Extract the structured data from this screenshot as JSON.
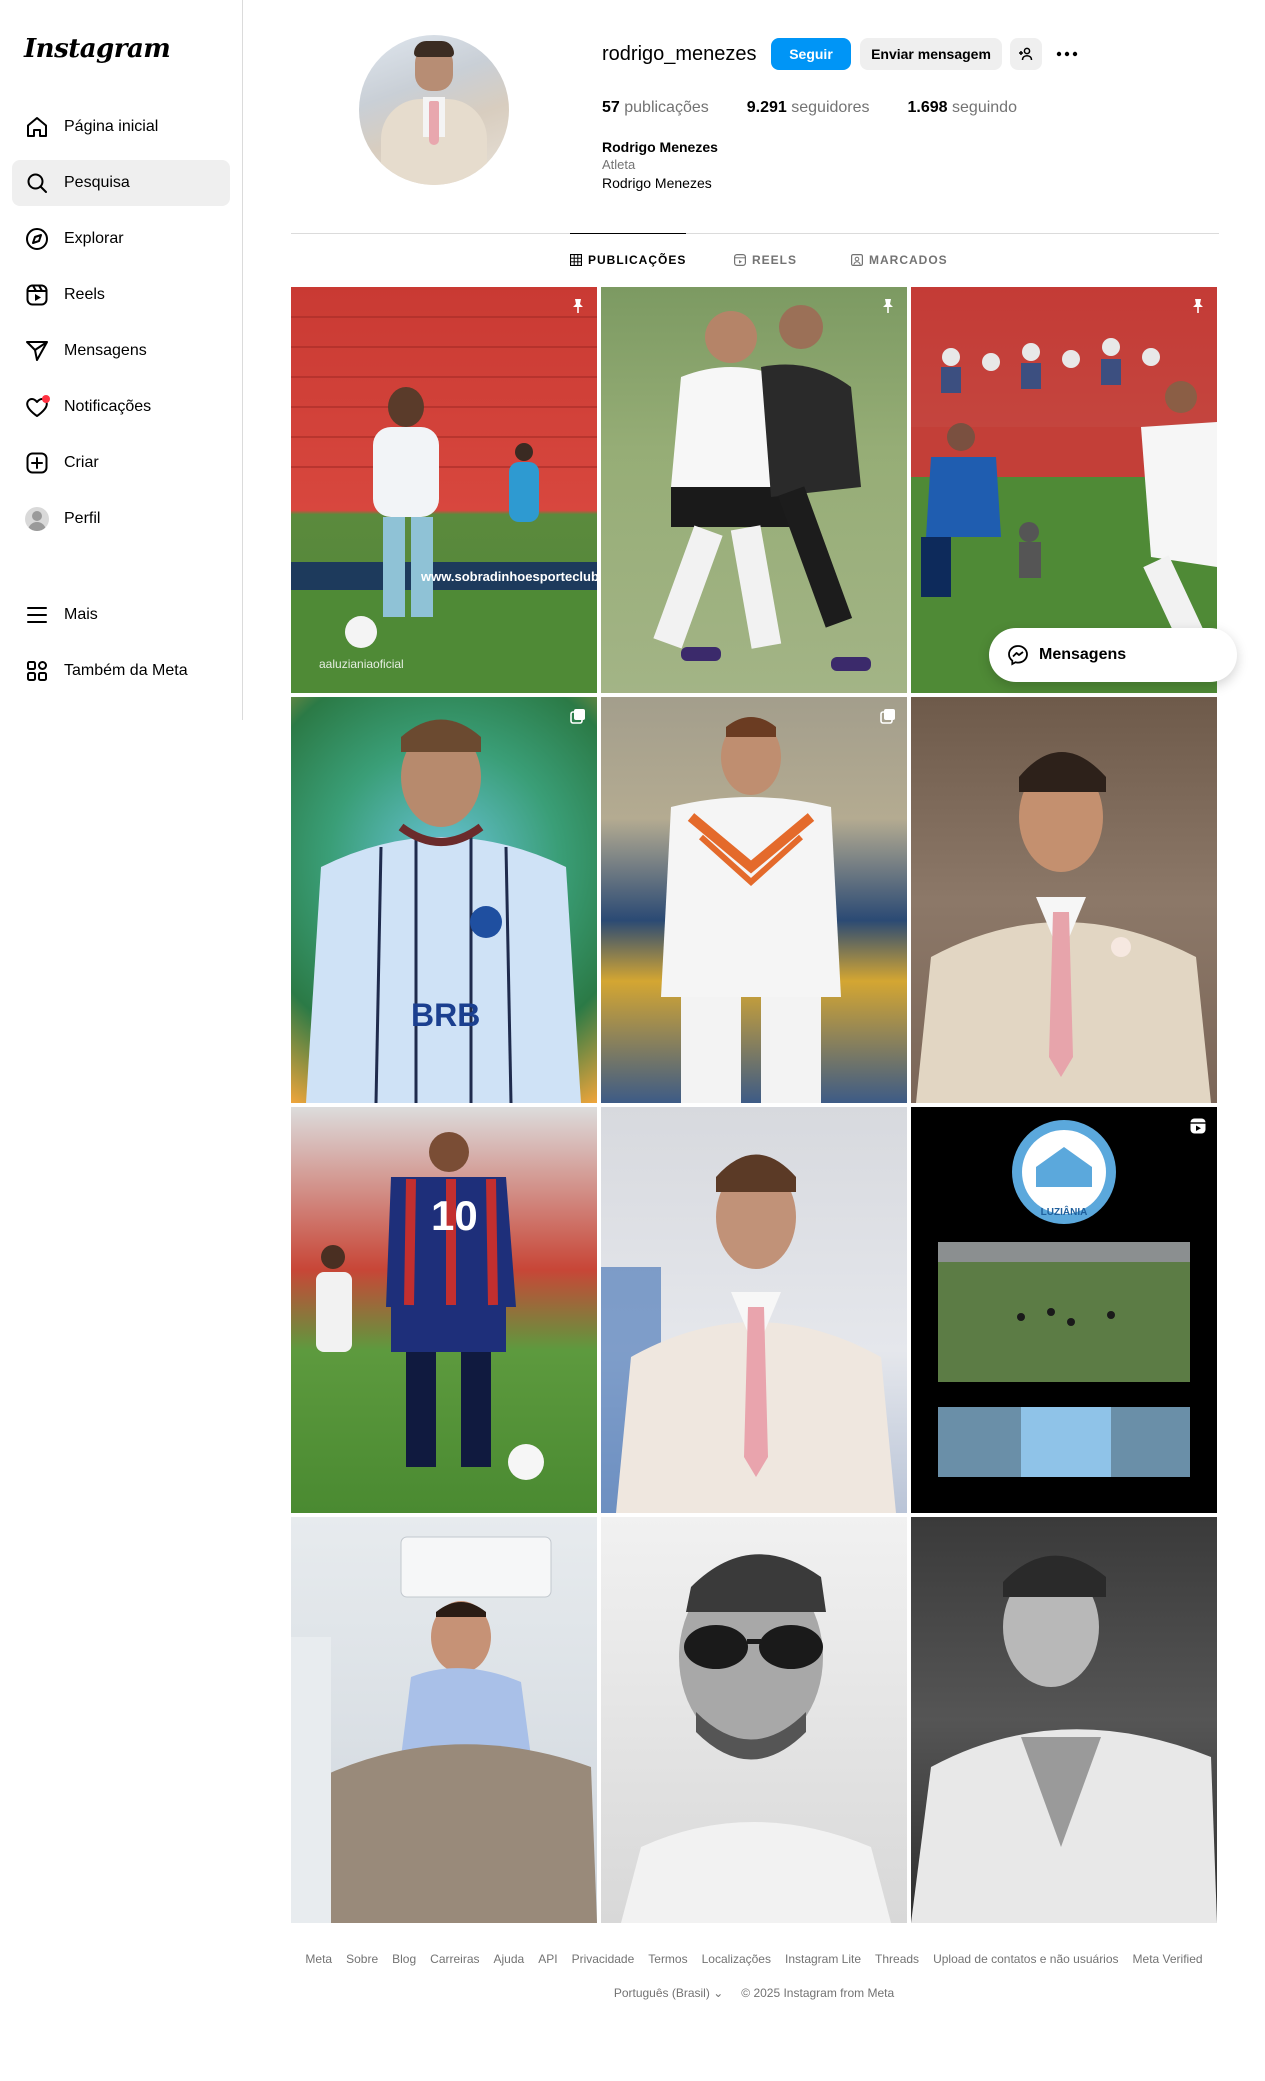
{
  "logo": "Instagram",
  "sidebar": {
    "items": [
      {
        "label": "Página inicial",
        "icon": "home-icon"
      },
      {
        "label": "Pesquisa",
        "icon": "search-icon"
      },
      {
        "label": "Explorar",
        "icon": "compass-icon"
      },
      {
        "label": "Reels",
        "icon": "reels-icon"
      },
      {
        "label": "Mensagens",
        "icon": "send-icon"
      },
      {
        "label": "Notificações",
        "icon": "heart-icon"
      },
      {
        "label": "Criar",
        "icon": "plus-square-icon"
      },
      {
        "label": "Perfil",
        "icon": "avatar"
      },
      {
        "label": "Mais",
        "icon": "menu-icon"
      },
      {
        "label": "Também da Meta",
        "icon": "meta-apps-icon"
      }
    ]
  },
  "profile": {
    "username": "rodrigo_menezes",
    "follow_label": "Seguir",
    "message_label": "Enviar mensagem",
    "posts_count": "57",
    "posts_label": "publicações",
    "followers_count": "9.291",
    "followers_label": "seguidores",
    "following_count": "1.698",
    "following_label": "seguindo",
    "full_name": "Rodrigo Menezes",
    "category": "Atleta",
    "bio": "Rodrigo Menezes"
  },
  "tabs": [
    {
      "label": "PUBLICAÇÕES"
    },
    {
      "label": "REELS"
    },
    {
      "label": "MARCADOS"
    }
  ],
  "posts": [
    {
      "theme": "soccer-stadium-red",
      "badge": "pin-icon",
      "text": "www.sobradinhoesporteclube",
      "caption": "aaluzianiaoficial"
    },
    {
      "theme": "soccer-corinthians",
      "badge": "pin-icon",
      "text": "",
      "caption": ""
    },
    {
      "theme": "soccer-crowd",
      "badge": "pin-icon",
      "text": "",
      "caption": ""
    },
    {
      "theme": "portrait-jersey-blue",
      "badge": "carousel-icon",
      "text": "BRB",
      "caption": ""
    },
    {
      "theme": "portrait-jersey-orange",
      "badge": "carousel-icon",
      "text": "",
      "caption": ""
    },
    {
      "theme": "portrait-suit",
      "badge": "",
      "text": "",
      "caption": ""
    },
    {
      "theme": "soccer-back-10",
      "badge": "",
      "text": "10",
      "caption": ""
    },
    {
      "theme": "portrait-suit-2",
      "badge": "",
      "text": "",
      "caption": ""
    },
    {
      "theme": "club-crest-video",
      "badge": "reel-icon",
      "text": "LUZIÂNIA",
      "caption": ""
    },
    {
      "theme": "hospital",
      "badge": "",
      "text": "",
      "caption": ""
    },
    {
      "theme": "bw-sunglasses",
      "badge": "",
      "text": "",
      "caption": ""
    },
    {
      "theme": "bw-portrait",
      "badge": "",
      "text": "",
      "caption": ""
    }
  ],
  "floating_messages": {
    "label": "Mensagens"
  },
  "footer": {
    "links": [
      "Meta",
      "Sobre",
      "Blog",
      "Carreiras",
      "Ajuda",
      "API",
      "Privacidade",
      "Termos",
      "Localizações",
      "Instagram Lite",
      "Threads",
      "Upload de contatos e não usuários",
      "Meta Verified"
    ],
    "language": "Português (Brasil)",
    "copyright": "© 2025 Instagram from Meta"
  },
  "colors": {
    "accent": "#0095f6",
    "notification_dot": "#ff3040",
    "secondary_text": "#737373",
    "border": "#dbdbdb"
  }
}
